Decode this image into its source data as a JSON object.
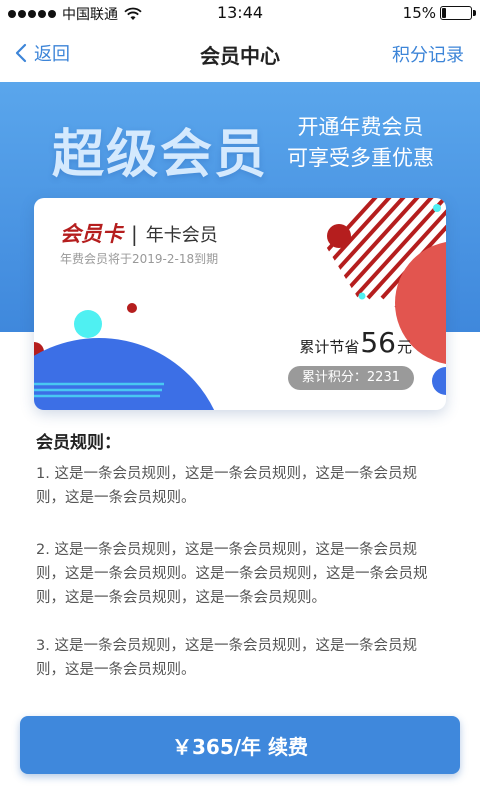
{
  "status_bar": {
    "carrier": "中国联通",
    "time": "13:44",
    "battery_text": "15%",
    "battery_level": 0.15,
    "signal_bars": 5
  },
  "nav": {
    "back_label": "返回",
    "title": "会员中心",
    "right_label": "积分记录"
  },
  "banner": {
    "title": "超级会员",
    "subtitle_line1": "开通年费会员",
    "subtitle_line2": "可享受多重优惠"
  },
  "card": {
    "brand": "会员卡",
    "separator": "|",
    "type": "年卡会员",
    "expiry": "年费会员将于2019-2-18到期",
    "saved_prefix": "累计节省",
    "saved_amount": "56",
    "saved_unit": "元",
    "points_text": "累计积分：2231"
  },
  "rules": {
    "heading": "会员规则：",
    "items": [
      "1. 这是一条会员规则，这是一条会员规则，这是一条会员规则，这是一条会员规则。",
      "2. 这是一条会员规则，这是一条会员规则，这是一条会员规则，这是一条会员规则。这是一条会员规则，这是一条会员规则，这是一条会员规则，这是一条会员规则。",
      "3. 这是一条会员规则，这是一条会员规则，这是一条会员规则，这是一条会员规则。"
    ]
  },
  "renew_button": "￥365/年  续费",
  "colors": {
    "accent": "#3f88dc",
    "banner_top": "#5aa6ec",
    "brand_red": "#b51e1e",
    "coral": "#e2554f",
    "cyan": "#4ff0f2",
    "card_blue": "#3c6fe6"
  },
  "icons": [
    "signal-icon",
    "wifi-icon",
    "battery-icon",
    "back-chevron-icon"
  ]
}
